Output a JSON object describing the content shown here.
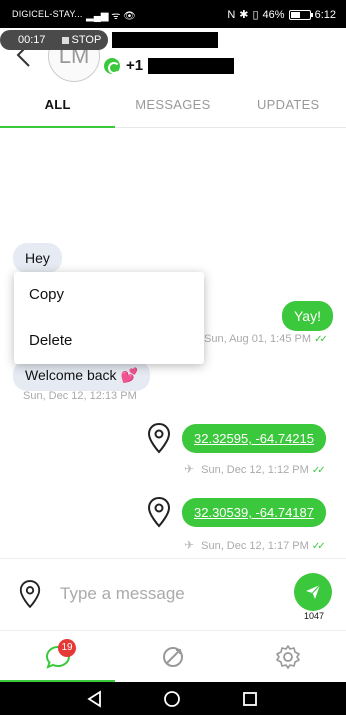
{
  "status_bar": {
    "carrier": "DIGICEL-STAY...",
    "battery": "46%",
    "time": "6:12"
  },
  "recording": {
    "elapsed": "00:17",
    "stop_label": "STOP"
  },
  "contact": {
    "initials": "LM",
    "phone_prefix": "+1"
  },
  "tabs": [
    {
      "label": "ALL",
      "active": true
    },
    {
      "label": "MESSAGES",
      "active": false
    },
    {
      "label": "UPDATES",
      "active": false
    }
  ],
  "messages": {
    "hey": {
      "text": "Hey"
    },
    "yay": {
      "text": "Yay!",
      "timestamp": "Sun, Aug 01, 1:45 PM"
    },
    "welcome": {
      "text": "Welcome back",
      "timestamp": "Sun, Dec 12, 12:13 PM"
    },
    "loc1": {
      "text": "32.32595, -64.74215",
      "timestamp": "Sun, Dec 12, 1:12 PM"
    },
    "loc2": {
      "text": "32.30539, -64.74187",
      "timestamp": "Sun, Dec 12, 1:17 PM"
    }
  },
  "context_menu": {
    "copy": "Copy",
    "delete": "Delete"
  },
  "composer": {
    "placeholder": "Type a message",
    "char_count": "1047"
  },
  "bottom_nav": {
    "badge": "19"
  },
  "colors": {
    "accent": "#3cc83c",
    "badge": "#e53935",
    "incoming_bubble": "#e6ebf3"
  }
}
